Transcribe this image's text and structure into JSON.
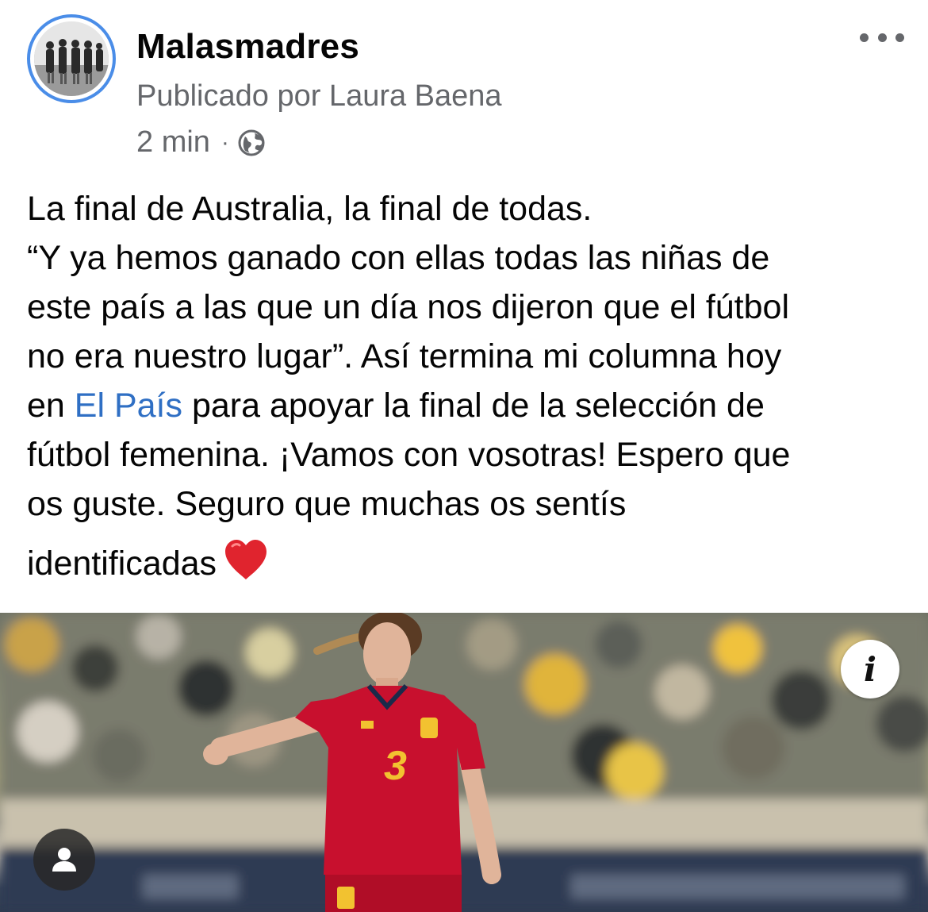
{
  "post": {
    "page_name": "Malasmadres",
    "byline": "Publicado por Laura Baena",
    "time": "2 min",
    "separator": "·",
    "audience_icon": "globe-icon",
    "more_icon": "more-options-icon"
  },
  "text": {
    "line1": "La final de Australia, la final de todas.",
    "line2": "“Y ya hemos ganado con ellas todas las niñas de",
    "line3": "este país a las que un día nos dijeron que el fútbol",
    "line4": "no era nuestro lugar”. Así termina mi columna hoy",
    "line5_pre": "en ",
    "line5_link": "El País",
    "line5_post": " para apoyar la final de la selección de",
    "line6": "fútbol femenina. ¡Vamos con vosotras! Espero que",
    "line7": "os guste. Seguro que muchas os sentís",
    "line8": "identificadas",
    "emoji": "red-heart-emoji"
  },
  "photo": {
    "info_label": "i",
    "info_icon": "info-icon",
    "profile_icon": "person-icon",
    "jersey_number": "3"
  },
  "colors": {
    "link": "#2f6fc4",
    "avatar_ring": "#4a8de8",
    "secondary_text": "#65676b",
    "jersey": "#c8102e"
  }
}
